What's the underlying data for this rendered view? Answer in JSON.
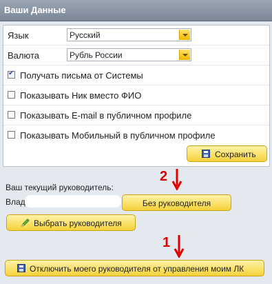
{
  "panel": {
    "title": "Ваши Данные"
  },
  "settings": {
    "language": {
      "label": "Язык",
      "value": "Русский"
    },
    "currency": {
      "label": "Валюта",
      "value": "Рубль России"
    },
    "checkboxes": [
      {
        "label": "Получать письма от Системы",
        "checked": true
      },
      {
        "label": "Показывать Ник вместо ФИО",
        "checked": false
      },
      {
        "label": "Показывать E-mail в публичном профиле",
        "checked": false
      },
      {
        "label": "Показывать Мобильный в публичном профиле",
        "checked": false
      }
    ],
    "save_label": "Сохранить"
  },
  "manager": {
    "current_label": "Ваш текущий руководитель:",
    "name_prefix": "Влад",
    "no_manager_label": "Без руководителя",
    "choose_label": "Выбрать руководителя",
    "disconnect_label": "Отключить моего руководителя от управления моим ЛК"
  },
  "annotations": {
    "step_2": "2",
    "step_1": "1",
    "color": "#e00000"
  },
  "icons": {
    "dropdown": "chevron-down-icon",
    "save": "floppy-disk-icon",
    "choose": "pencil-icon"
  }
}
